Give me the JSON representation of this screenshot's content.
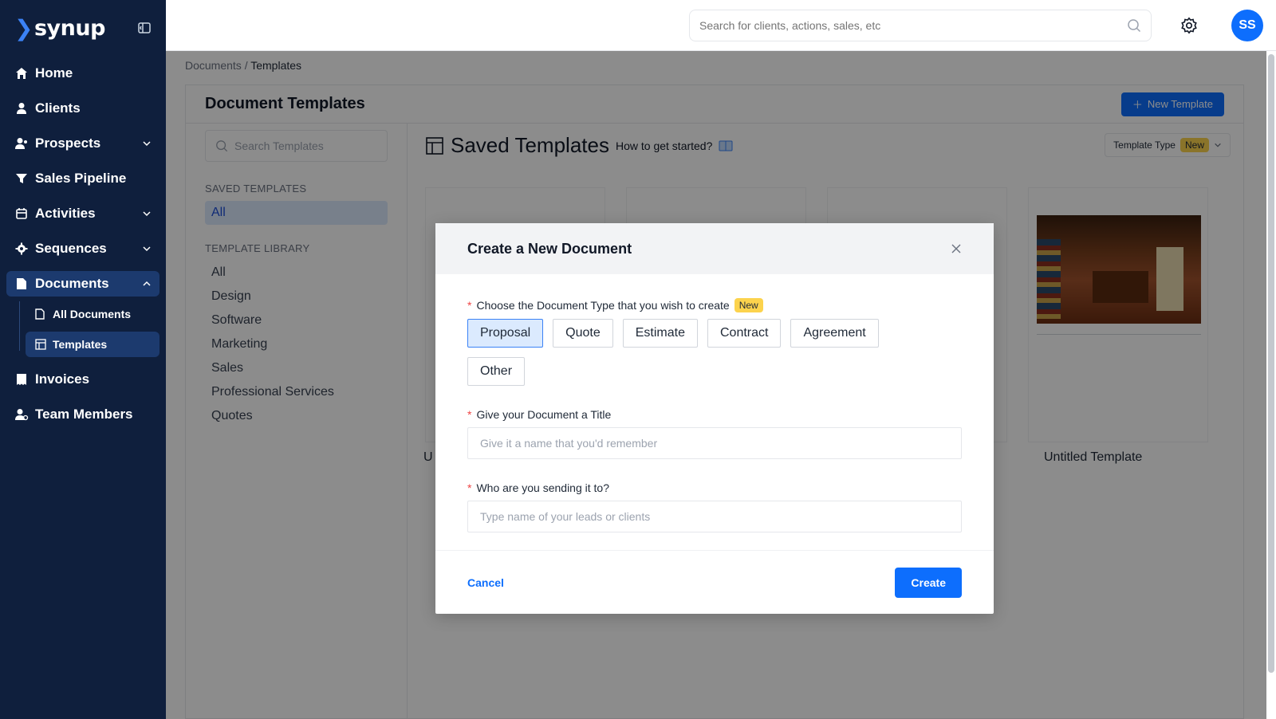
{
  "brand": {
    "name": "synup",
    "accent": "#0d6efd",
    "sidebar_bg": "#0f1f3d"
  },
  "sidebar": {
    "items": [
      {
        "label": "Home",
        "icon": "home-icon"
      },
      {
        "label": "Clients",
        "icon": "person-icon"
      },
      {
        "label": "Prospects",
        "icon": "prospects-icon"
      },
      {
        "label": "Sales Pipeline",
        "icon": "funnel-icon"
      },
      {
        "label": "Activities",
        "icon": "calendar-icon"
      },
      {
        "label": "Sequences",
        "icon": "sequences-icon"
      },
      {
        "label": "Documents",
        "icon": "document-icon"
      },
      {
        "label": "Invoices",
        "icon": "invoice-icon"
      },
      {
        "label": "Team Members",
        "icon": "team-icon"
      }
    ],
    "documents_sub": [
      {
        "label": "All Documents",
        "icon": "file-icon"
      },
      {
        "label": "Templates",
        "icon": "template-icon"
      }
    ]
  },
  "header": {
    "search_placeholder": "Search for clients, actions, sales, etc",
    "avatar_initials": "SS"
  },
  "breadcrumb": {
    "parent": "Documents",
    "separator": " / ",
    "current": "Templates"
  },
  "page": {
    "title": "Document Templates",
    "new_template_label": "New Template",
    "library_search_placeholder": "Search Templates",
    "saved_heading": "SAVED TEMPLATES",
    "saved_items": [
      "All"
    ],
    "library_heading": "TEMPLATE LIBRARY",
    "library_items": [
      "All",
      "Design",
      "Software",
      "Marketing",
      "Sales",
      "Professional Services",
      "Quotes"
    ],
    "saved_title": "Saved Templates",
    "how_to": "How to get started?",
    "template_type_label": "Template Type",
    "template_type_badge": "New",
    "card_labels": [
      "U",
      "Untitled Template"
    ]
  },
  "modal": {
    "title": "Create a New Document",
    "type_label": "Choose the Document Type that you wish to create",
    "type_badge": "New",
    "types": [
      "Proposal",
      "Quote",
      "Estimate",
      "Contract",
      "Agreement",
      "Other"
    ],
    "selected_type": "Proposal",
    "title_label": "Give your Document a Title",
    "title_placeholder": "Give it a name that you'd remember",
    "recipient_label": "Who are you sending it to?",
    "recipient_placeholder": "Type name of your leads or clients",
    "cancel_label": "Cancel",
    "create_label": "Create"
  }
}
